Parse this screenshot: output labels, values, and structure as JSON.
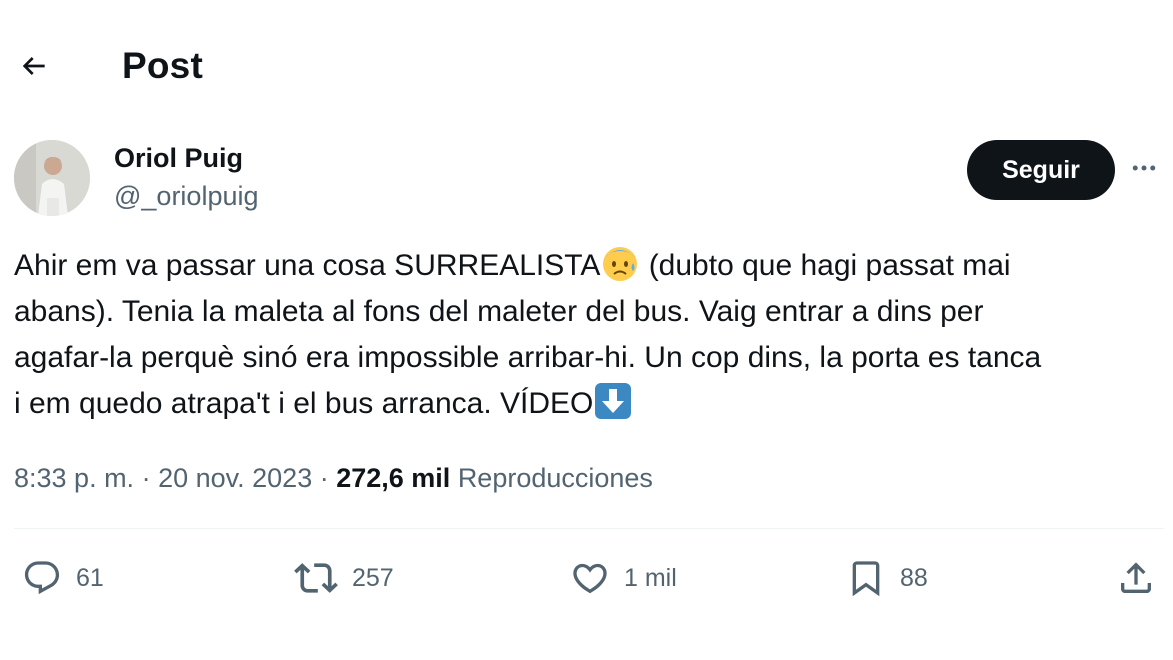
{
  "header": {
    "title": "Post"
  },
  "author": {
    "name": "Oriol Puig",
    "handle": "@_oriolpuig",
    "follow_label": "Seguir"
  },
  "tweet": {
    "line1_a": "Ahir em va passar una cosa SURREALISTA",
    "line1_b": " (dubto que hagi passat mai",
    "line2": "abans). Tenia la maleta al fons del maleter del bus. Vaig entrar a dins per",
    "line3": "agafar-la perquè sinó era impossible arribar-hi. Un cop dins, la porta es tanca",
    "line4": "i em quedo atrapa't i el bus arranca. VÍDEO",
    "emojis": [
      "anxious-face-with-sweat-emoji",
      "down-arrow-emoji"
    ]
  },
  "meta": {
    "time": "8:33 p. m.",
    "sep1": " · ",
    "date": "20 nov. 2023",
    "sep2": " · ",
    "views_count": "272,6 mil",
    "views_label": "Reproducciones"
  },
  "actions": {
    "replies": "61",
    "reposts": "257",
    "likes": "1 mil",
    "bookmarks": "88"
  },
  "icons": {
    "back": "arrow-left-icon",
    "more": "more-horizontal-icon",
    "reply": "comment-icon",
    "repost": "repost-icon",
    "like": "heart-icon",
    "bookmark": "bookmark-icon",
    "share": "share-icon"
  },
  "colors": {
    "text": "#0f1419",
    "secondary": "#536471",
    "button": "#0f1419",
    "divider": "#eff3f4",
    "emoji_key": "#3b88c3"
  }
}
